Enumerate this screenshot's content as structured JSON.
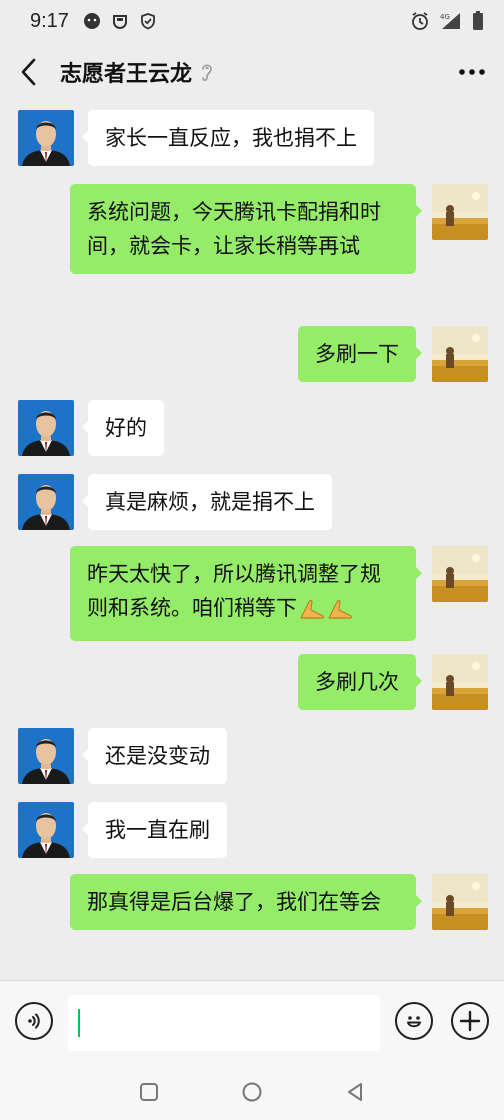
{
  "status_bar": {
    "time": "9:17",
    "network_label": "4G"
  },
  "header": {
    "title": "志愿者王云龙"
  },
  "messages": [
    {
      "side": "left",
      "text": "家长一直反应，我也捐不上"
    },
    {
      "side": "right",
      "text": "系统问题，今天腾讯卡配捐和时间，就会卡，让家长稍等再试"
    },
    {
      "side": "right",
      "text": "多刷一下"
    },
    {
      "side": "left",
      "text": "好的"
    },
    {
      "side": "left",
      "text": "真是麻烦，就是捐不上"
    },
    {
      "side": "right",
      "text": "昨天太快了，所以腾讯调整了规则和系统。咱们稍等下",
      "emoji": [
        "folded-hands",
        "folded-hands"
      ]
    },
    {
      "side": "right",
      "text": "多刷几次"
    },
    {
      "side": "left",
      "text": "还是没变动"
    },
    {
      "side": "left",
      "text": "我一直在刷"
    },
    {
      "side": "right",
      "text": "那真得是后台爆了，我们在等会"
    }
  ],
  "input": {
    "value": ""
  },
  "colors": {
    "background": "#ededed",
    "sent_bubble": "#95ec69",
    "received_bubble": "#ffffff",
    "caret": "#07c160"
  }
}
